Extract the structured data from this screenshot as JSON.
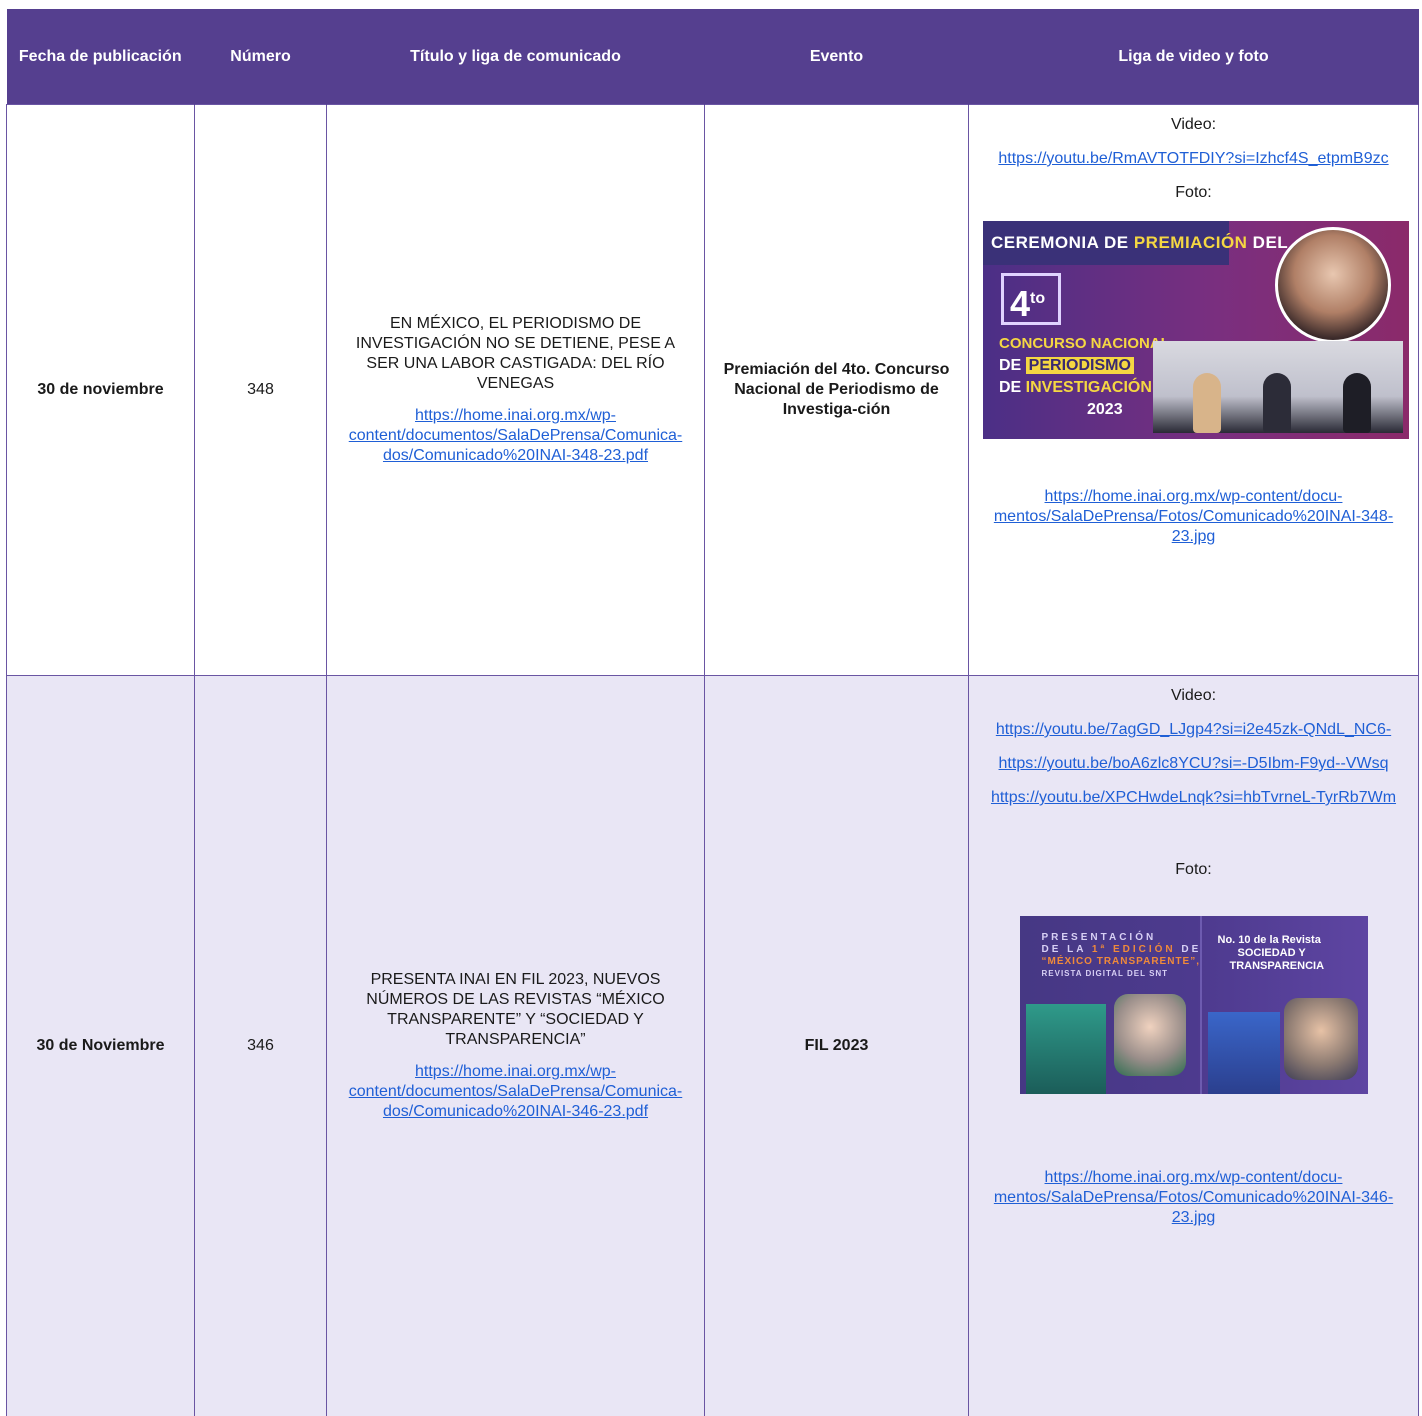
{
  "header": {
    "fecha": "Fecha de publicación",
    "numero": "Número",
    "titulo": "Título y liga de comunicado",
    "evento": "Evento",
    "liga": "Liga de video y foto"
  },
  "colors": {
    "header_bg": "#553f8f",
    "row_alt_bg": "#e9e6f5",
    "link": "#1f5fd6"
  },
  "rows": [
    {
      "fecha": "30 de noviembre",
      "numero": "348",
      "titulo": "EN MÉXICO, EL PERIODISMO DE INVESTIGACIÓN NO SE DETIENE, PESE A SER UNA LABOR CASTIGADA: DEL RÍO VENEGAS",
      "titulo_link": "https://home.inai.org.mx/wp-content/documentos/SalaDePrensa/Comunica-dos/Comunicado%20INAI-348-23.pdf",
      "evento": "Premiación del 4to. Concurso Nacional de Periodismo de Investiga-ción",
      "video_label": "Video:",
      "videos": [
        "https://youtu.be/RmAVTOTFDIY?si=Izhcf4S_etpmB9zc"
      ],
      "foto_label": "Foto:",
      "foto_link": "https://home.inai.org.mx/wp-content/docu-mentos/SalaDePrensa/Fotos/Comunicado%20INAI-348-23.jpg",
      "photo": {
        "banner_a": "CEREMONIA DE ",
        "banner_b": "PREMIACIÓN",
        "banner_c": " DEL",
        "num": "4",
        "num_sup": "to",
        "line1": "CONCURSO NACIONAL",
        "line2a": "DE ",
        "line2b": "PERIODISMO",
        "line3a": "DE ",
        "line3b": "INVESTIGACIÓN",
        "year": "2023"
      }
    },
    {
      "fecha": "30 de Noviembre",
      "numero": "346",
      "titulo": "PRESENTA INAI EN FIL 2023, NUEVOS NÚMEROS DE LAS REVISTAS “MÉXICO TRANSPARENTE” Y “SOCIEDAD Y TRANSPARENCIA”",
      "titulo_link": "https://home.inai.org.mx/wp-content/documentos/SalaDePrensa/Comunica-dos/Comunicado%20INAI-346-23.pdf",
      "evento": "FIL 2023",
      "video_label": "Video:",
      "videos": [
        "https://youtu.be/7agGD_LJgp4?si=i2e45zk-QNdL_NC6-",
        "https://youtu.be/boA6zlc8YCU?si=-D5Ibm-F9yd--VWsq",
        "https://youtu.be/XPCHwdeLnqk?si=hbTvrneL-TyrRb7Wm"
      ],
      "foto_label": "Foto:",
      "foto_link": "https://home.inai.org.mx/wp-content/docu-mentos/SalaDePrensa/Fotos/Comunicado%20INAI-346-23.jpg",
      "photo": {
        "left_1": "PRESENTACIÓN",
        "left_2a": "DE LA ",
        "left_2b": "1ª EDICIÓN",
        "left_2c": " DE",
        "left_3": "“MÉXICO TRANSPARENTE”,",
        "left_4": "REVISTA DIGITAL DEL SNT",
        "right_1": "No. 10 de la Revista",
        "right_2": "SOCIEDAD Y",
        "right_3": "TRANSPARENCIA"
      }
    }
  ]
}
